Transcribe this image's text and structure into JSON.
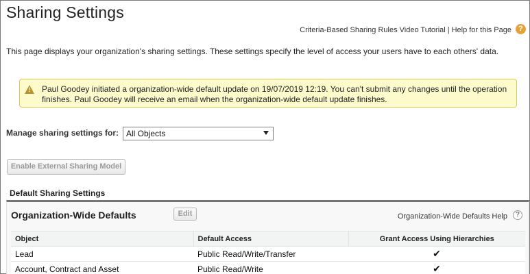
{
  "header": {
    "title": "Sharing Settings",
    "links": [
      "Criteria-Based Sharing Rules Video Tutorial",
      "Help for this Page"
    ],
    "link_separator": "|",
    "help_badge": "?"
  },
  "intro_text": "This page displays your organization's sharing settings. These settings specify the level of access your users have to each others' data.",
  "warning": {
    "icon": "warning-triangle-icon",
    "text": "Paul Goodey initiated a organization-wide default update on 19/07/2019 12:19. You can't submit any changes until the operation finishes. Paul Goodey will receive an email when the organization-wide default update finishes."
  },
  "manage": {
    "label": "Manage sharing settings for:",
    "selected": "All Objects"
  },
  "external_button_label": "Enable External Sharing Model",
  "default_sharing_heading": "Default Sharing Settings",
  "owd": {
    "title": "Organization-Wide Defaults",
    "edit_label": "Edit",
    "help_label": "Organization-Wide Defaults Help",
    "help_icon": "?",
    "columns": [
      "Object",
      "Default Access",
      "Grant Access Using Hierarchies"
    ],
    "rows": [
      {
        "object": "Lead",
        "access": "Public Read/Write/Transfer",
        "grant": "✔"
      },
      {
        "object": "Account, Contract and Asset",
        "access": "Public Read/Write",
        "grant": "✔"
      }
    ]
  },
  "colors": {
    "warning_bg": "#fdfbcc",
    "warning_border": "#d6c95a",
    "help_badge": "#e2a33a",
    "panel_top_border": "#747474"
  }
}
